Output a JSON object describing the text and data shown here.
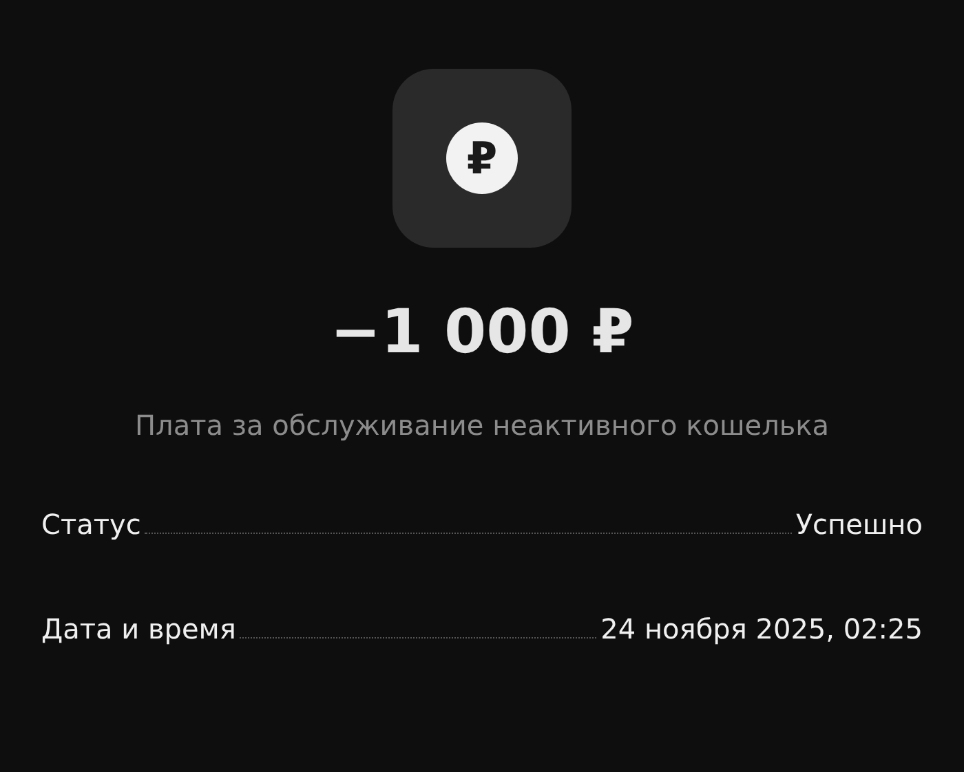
{
  "icon": {
    "glyph": "₽"
  },
  "amount": "−1 000 ₽",
  "description": "Плата за обслуживание неактивного кошелька",
  "details": [
    {
      "label": "Статус",
      "value": "Успешно"
    },
    {
      "label": "Дата и время",
      "value": "24 ноября 2025, 02:25"
    }
  ]
}
